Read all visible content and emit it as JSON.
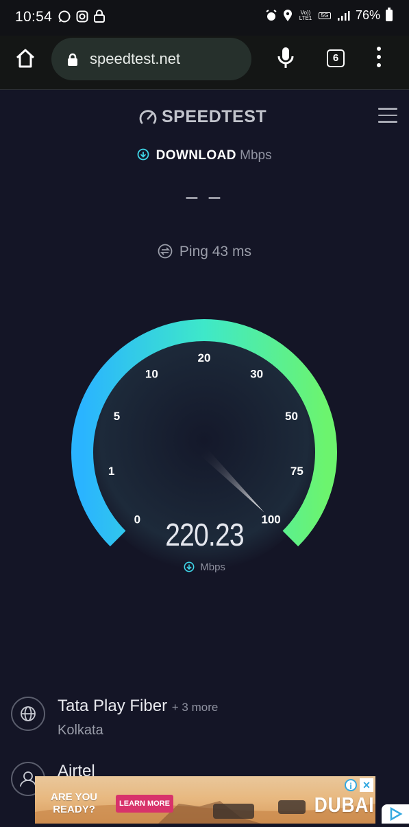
{
  "status_bar": {
    "time": "10:54",
    "battery": "76%",
    "left_icons": [
      "whatsapp-icon",
      "instagram-icon",
      "lock-icon"
    ],
    "right_icons": [
      "alarm-icon",
      "location-icon",
      "volte-icon",
      "5g-icon",
      "signal-icon",
      "battery-icon"
    ],
    "volte_label": "Vo)) LTE1",
    "network_label": "5G"
  },
  "browser": {
    "url": "speedtest.net",
    "tab_count": "6"
  },
  "speedtest": {
    "logo": "SPEEDTEST",
    "download_label": "DOWNLOAD",
    "download_unit": "Mbps",
    "download_value": "– –",
    "ping_label": "Ping 43 ms",
    "gauge": {
      "ticks": [
        "0",
        "1",
        "5",
        "10",
        "20",
        "30",
        "50",
        "75",
        "100"
      ],
      "reading": "220.23",
      "unit": "Mbps",
      "needle_fraction": 1.0,
      "colors": {
        "start": "#2ab4ff",
        "mid": "#2ee6d6",
        "end": "#68f772"
      }
    }
  },
  "servers": [
    {
      "name": "Tata Play Fiber",
      "more": "+ 3 more",
      "location": "Kolkata"
    },
    {
      "name": "Airtel"
    }
  ],
  "ad": {
    "headline_1": "ARE YOU",
    "headline_2": "READY?",
    "cta": "LEARN MORE",
    "brand": "DUBAI"
  }
}
